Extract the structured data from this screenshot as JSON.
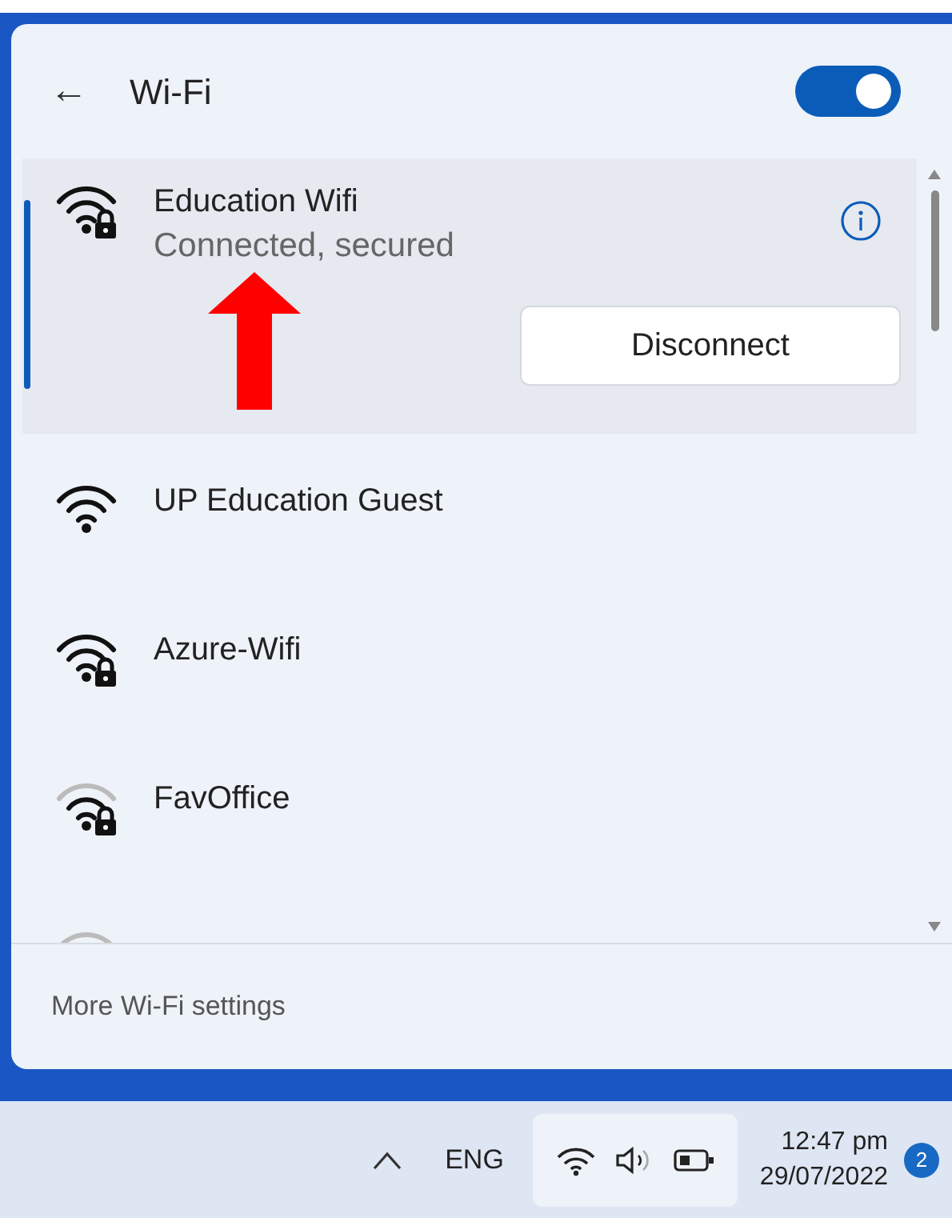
{
  "header": {
    "back": "←",
    "title": "Wi-Fi",
    "wifi_on": true
  },
  "networks": [
    {
      "name": "Education Wifi",
      "status": "Connected, secured",
      "secured": true,
      "weak_signal": false,
      "selected": true,
      "action": "Disconnect"
    },
    {
      "name": "UP Education Guest",
      "secured": false,
      "weak_signal": false,
      "selected": false
    },
    {
      "name": "Azure-Wifi",
      "secured": true,
      "weak_signal": false,
      "selected": false
    },
    {
      "name": "FavOffice",
      "secured": true,
      "weak_signal": true,
      "selected": false
    },
    {
      "secured": false,
      "weak_signal": true,
      "selected": false
    }
  ],
  "footer": {
    "link": "More Wi-Fi settings"
  },
  "taskbar": {
    "language": "ENG",
    "time": "12:47 pm",
    "date": "29/07/2022",
    "notifications": "2"
  }
}
